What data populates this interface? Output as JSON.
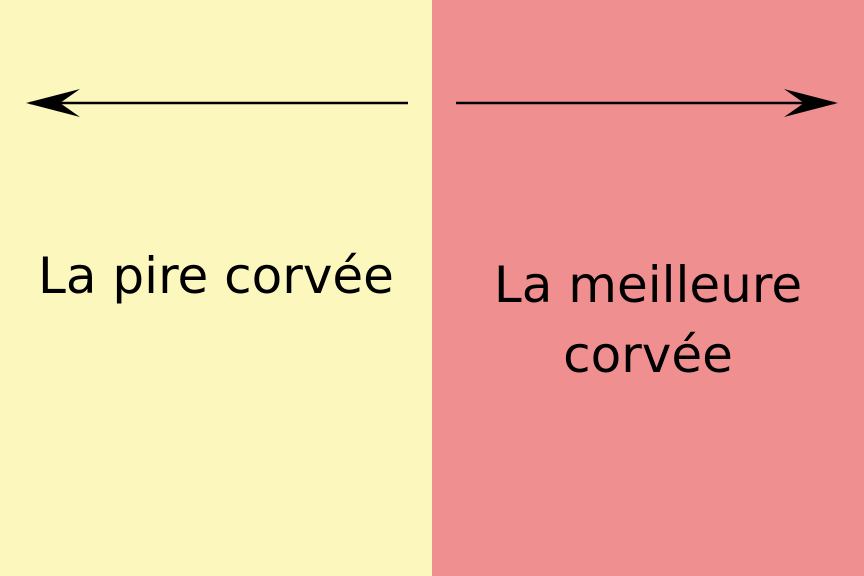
{
  "colors": {
    "left_background": "#FCF7BC",
    "right_background": "#EF8F8F",
    "arrow": "#000000",
    "text": "#000000"
  },
  "left_panel": {
    "label": "La pire corvée",
    "arrow_direction": "left"
  },
  "right_panel": {
    "label_lines": [
      "La meilleure",
      "corvée"
    ],
    "arrow_direction": "right"
  }
}
